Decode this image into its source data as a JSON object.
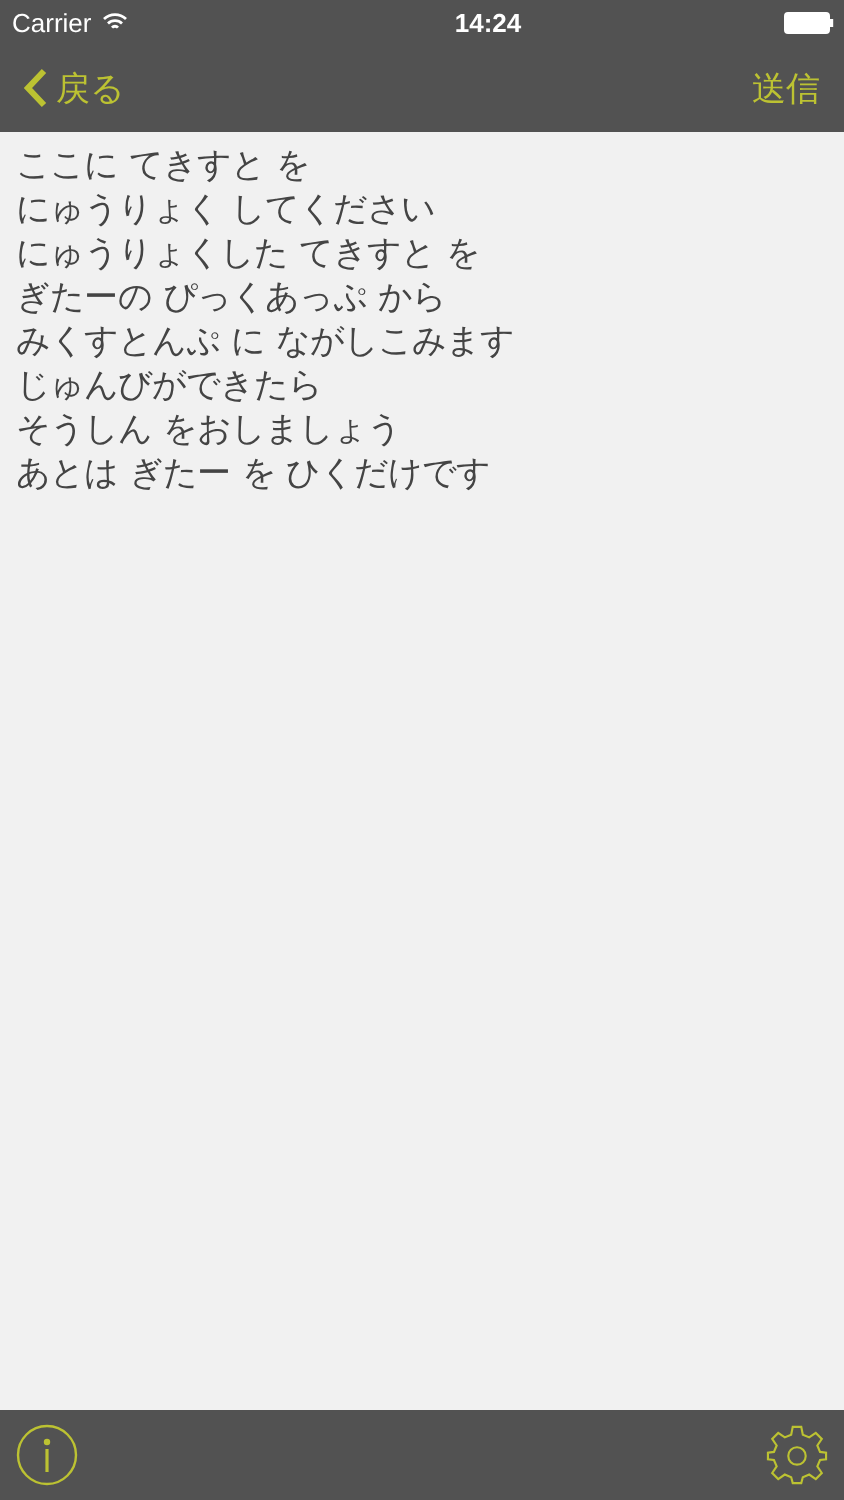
{
  "status_bar": {
    "carrier": "Carrier",
    "time": "14:24"
  },
  "nav_bar": {
    "back_label": "戻る",
    "action_label": "送信"
  },
  "text_view": {
    "lines": [
      "ここに てきすと を",
      "にゅうりょく してください",
      "にゅうりょくした てきすと を",
      "ぎたーの ぴっくあっぷ から",
      "みくすとんぷ に ながしこみます",
      "じゅんびができたら",
      "そうしん をおしましょう",
      "あとは ぎたー を ひくだけです"
    ]
  }
}
